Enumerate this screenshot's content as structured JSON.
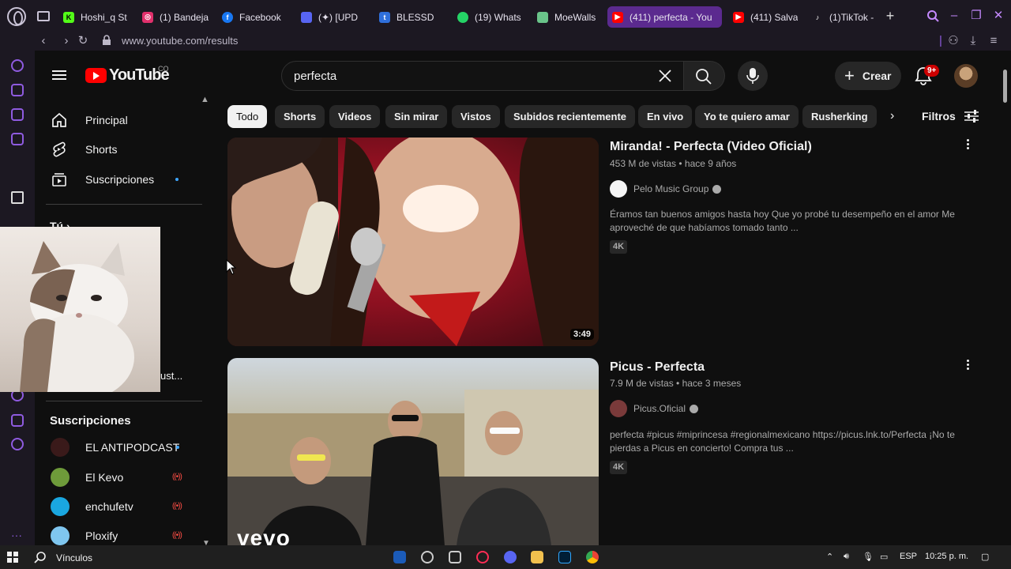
{
  "browser": {
    "tabs": [
      {
        "label": "Hoshi_q St",
        "icon": "kick-icon",
        "color": "#53fc18"
      },
      {
        "label": "(1) Bandeja",
        "icon": "instagram-icon",
        "color": "#e1306c"
      },
      {
        "label": "Facebook",
        "icon": "facebook-icon",
        "color": "#1877f2"
      },
      {
        "label": "(✦) [UPD",
        "icon": "discord-like-icon",
        "color": "#5865f2"
      },
      {
        "label": "BLESSD",
        "icon": "tumblr-icon",
        "color": "#2f6fdb"
      },
      {
        "label": "(19) Whats",
        "icon": "whatsapp-icon",
        "color": "#25d366"
      },
      {
        "label": "MoeWalls",
        "icon": "moewalls-icon",
        "color": "#6ac48a"
      },
      {
        "label": "(411) perfecta - You",
        "icon": "youtube-icon",
        "color": "#ff0000",
        "active": true
      },
      {
        "label": "(411) Salva",
        "icon": "youtube-icon",
        "color": "#ff0000"
      },
      {
        "label": "(1)TikTok -",
        "icon": "tiktok-icon",
        "color": "#ffffff"
      }
    ],
    "url": "www.youtube.com/results"
  },
  "youtube": {
    "logo_text": "YouTube",
    "country_code": "CO",
    "search_value": "perfecta",
    "create_label": "Crear",
    "notifications_count": "9+",
    "guide": {
      "items": [
        {
          "label": "Principal",
          "icon": "home-icon"
        },
        {
          "label": "Shorts",
          "icon": "shorts-icon"
        },
        {
          "label": "Suscripciones",
          "icon": "subscriptions-icon"
        }
      ],
      "you_label": "Tú",
      "partial_text": "ust...",
      "subscriptions_heading": "Suscripciones",
      "subscriptions": [
        {
          "label": "EL ANTIPODCAST",
          "color": "#3a1a1a",
          "status": "new"
        },
        {
          "label": "El Kevo",
          "color": "#6e9b3a",
          "status": "live"
        },
        {
          "label": "enchufetv",
          "color": "#1aa7e0",
          "status": "live"
        },
        {
          "label": "Ploxify",
          "color": "#7fc6ef",
          "status": "live"
        }
      ]
    },
    "chips": [
      "Todo",
      "Shorts",
      "Videos",
      "Sin mirar",
      "Vistos",
      "Subidos recientemente",
      "En vivo",
      "Yo te quiero amar",
      "Rusherking"
    ],
    "filters_label": "Filtros",
    "results": [
      {
        "title": "Miranda! - Perfecta (Video Oficial)",
        "meta": "453 M de vistas • hace 9 años",
        "channel": "Pelo Music Group",
        "description": "Éramos tan buenos amigos hasta hoy Que yo probé tu desempeño en el amor Me aproveché de que habíamos tomado tanto ...",
        "badge": "4K",
        "duration": "3:49"
      },
      {
        "title": "Picus - Perfecta",
        "meta": "7.9 M de vistas • hace 3 meses",
        "channel": "Picus.Oficial",
        "description": "perfecta #picus #miprincesa #regionalmexicano https://picus.lnk.to/Perfecta ¡No te pierdas a Picus en concierto! Compra tus ...",
        "badge": "4K",
        "watermark": "vevo"
      }
    ]
  },
  "taskbar": {
    "search_label": "Vínculos",
    "language": "ESP",
    "time": "10:25 p. m."
  }
}
